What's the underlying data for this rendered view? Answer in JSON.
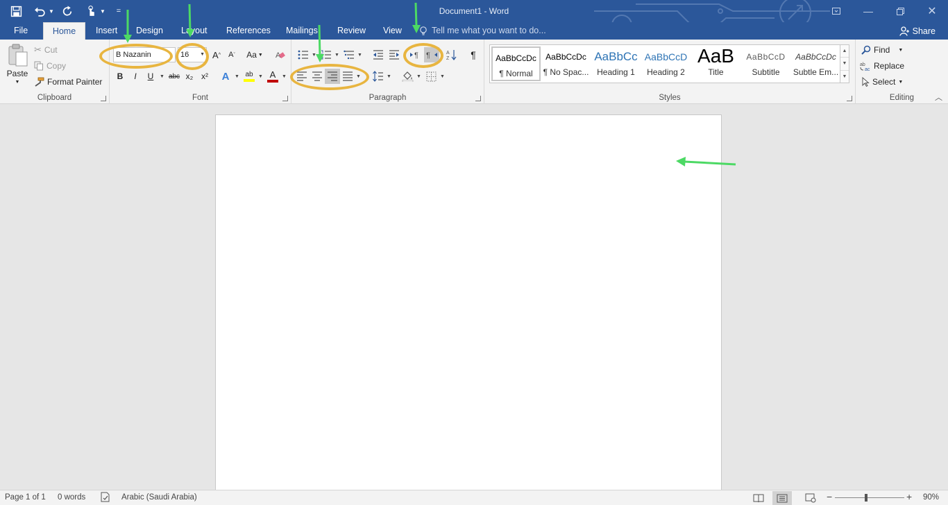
{
  "window": {
    "title": "Document1 - Word"
  },
  "tabs": [
    {
      "label": "File"
    },
    {
      "label": "Home"
    },
    {
      "label": "Insert"
    },
    {
      "label": "Design"
    },
    {
      "label": "Layout"
    },
    {
      "label": "References"
    },
    {
      "label": "Mailings"
    },
    {
      "label": "Review"
    },
    {
      "label": "View"
    }
  ],
  "tell_me": {
    "placeholder": "Tell me what you want to do..."
  },
  "share_label": "Share",
  "clipboard": {
    "paste_label": "Paste",
    "cut_label": "Cut",
    "copy_label": "Copy",
    "format_painter_label": "Format Painter",
    "group_label": "Clipboard"
  },
  "font": {
    "font_name": "B Nazanin",
    "font_size": "16",
    "group_label": "Font",
    "bold": "B",
    "italic": "I",
    "underline": "U",
    "strikethrough": "abc",
    "subscript": "x₂",
    "superscript": "x²",
    "grow": "A",
    "shrink": "A",
    "change_case": "Aa",
    "text_effects": "A",
    "font_color": "A"
  },
  "paragraph": {
    "group_label": "Paragraph",
    "show_marks": "¶"
  },
  "styles": {
    "group_label": "Styles",
    "items": [
      {
        "sample": "AaBbCcDc",
        "name": "¶ Normal"
      },
      {
        "sample": "AaBbCcDc",
        "name": "¶ No Spac..."
      },
      {
        "sample": "AaBbCc",
        "name": "Heading 1"
      },
      {
        "sample": "AaBbCcD",
        "name": "Heading 2"
      },
      {
        "sample": "AaB",
        "name": "Title"
      },
      {
        "sample": "AaBbCcD",
        "name": "Subtitle"
      },
      {
        "sample": "AaBbCcDc",
        "name": "Subtle Em..."
      }
    ]
  },
  "editing": {
    "group_label": "Editing",
    "find_label": "Find",
    "replace_label": "Replace",
    "select_label": "Select"
  },
  "status": {
    "page": "Page 1 of 1",
    "words": "0 words",
    "language": "Arabic (Saudi Arabia)",
    "zoom": "90%",
    "zoom_level": 0.45
  },
  "colors": {
    "brand": "#2b579a",
    "annotation_ring": "#e8b540",
    "annotation_arrow": "#4cd964",
    "font_color_bar": "#c00000",
    "highlight_bar": "#ffff00"
  }
}
